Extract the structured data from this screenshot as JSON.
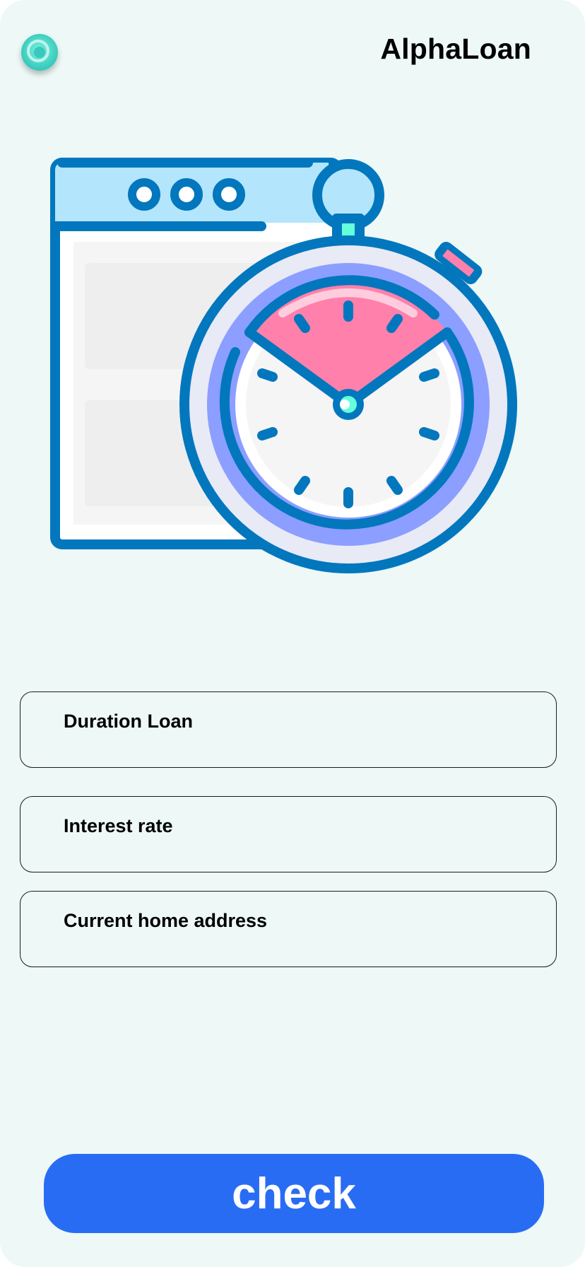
{
  "header": {
    "logo_icon": "target-ring-icon",
    "title": "AlphaLoan"
  },
  "illustration": {
    "name": "browser-window-with-stopwatch",
    "colors": {
      "outline": "#0277bd",
      "window_bar": "#b3e5fc",
      "dial_ring": "#8c9eff",
      "dial_outer": "#e8eaf6",
      "sector": "#ff80ab",
      "face": "#f5f5f5",
      "accent": "#64ffda"
    }
  },
  "form": {
    "fields": [
      {
        "label": "Duration Loan",
        "value": ""
      },
      {
        "label": "Interest rate",
        "value": ""
      },
      {
        "label": "Current home address",
        "value": ""
      }
    ]
  },
  "actions": {
    "check_label": "check",
    "check_color": "#296cf4"
  },
  "theme": {
    "background": "#edf8f7"
  }
}
